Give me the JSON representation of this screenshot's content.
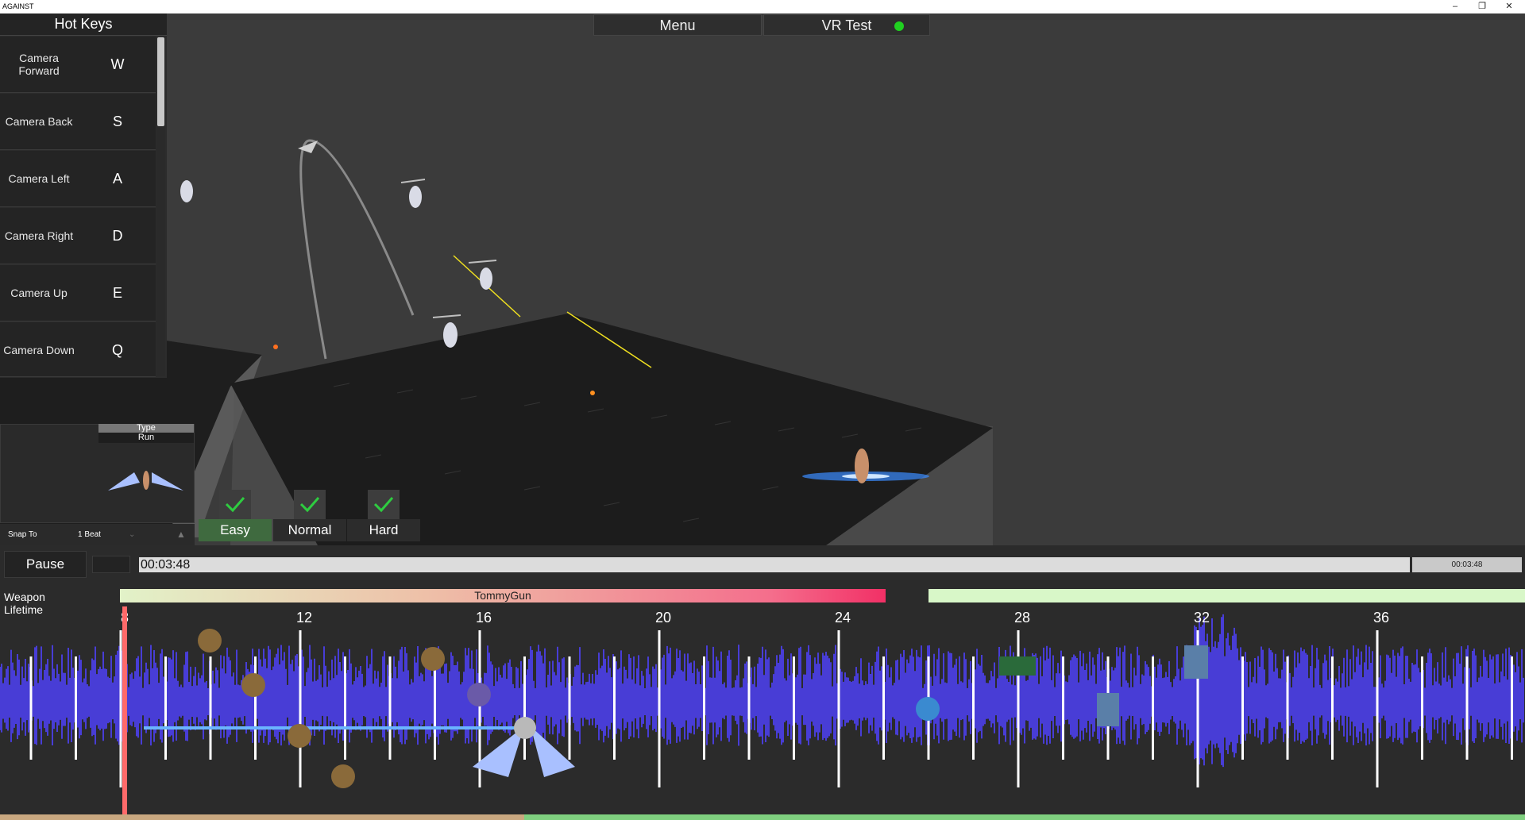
{
  "window": {
    "title": "AGAINST",
    "minimize": "–",
    "restore": "❐",
    "close": "✕"
  },
  "top_menu": {
    "menu": "Menu",
    "vr_test": "VR Test",
    "vr_status_color": "#20d020"
  },
  "hotkeys": {
    "title": "Hot Keys",
    "items": [
      {
        "label": "Camera Forward",
        "key": "W"
      },
      {
        "label": "Camera Back",
        "key": "S"
      },
      {
        "label": "Camera Left",
        "key": "A"
      },
      {
        "label": "Camera Right",
        "key": "D"
      },
      {
        "label": "Camera Up",
        "key": "E"
      },
      {
        "label": "Camera Down",
        "key": "Q"
      }
    ]
  },
  "preview": {
    "type_label": "Type",
    "type_value": "Run"
  },
  "snap": {
    "label": "Snap To",
    "value": "1 Beat"
  },
  "difficulty": {
    "items": [
      {
        "label": "Easy",
        "checked": true,
        "active": true
      },
      {
        "label": "Normal",
        "checked": true,
        "active": false
      },
      {
        "label": "Hard",
        "checked": true,
        "active": false
      }
    ],
    "check_color": "#2ecc40"
  },
  "playback": {
    "pause_label": "Pause",
    "current_time": "00:03:48",
    "end_time": "00:03:48"
  },
  "weapon": {
    "label": "Weapon Lifetime",
    "name": "TommyGun"
  },
  "beats": {
    "labels": [
      "8",
      "12",
      "16",
      "20",
      "24",
      "28",
      "32",
      "36"
    ],
    "waveform_color": "#4a3ee0",
    "playhead_color": "#ff6a6a"
  }
}
